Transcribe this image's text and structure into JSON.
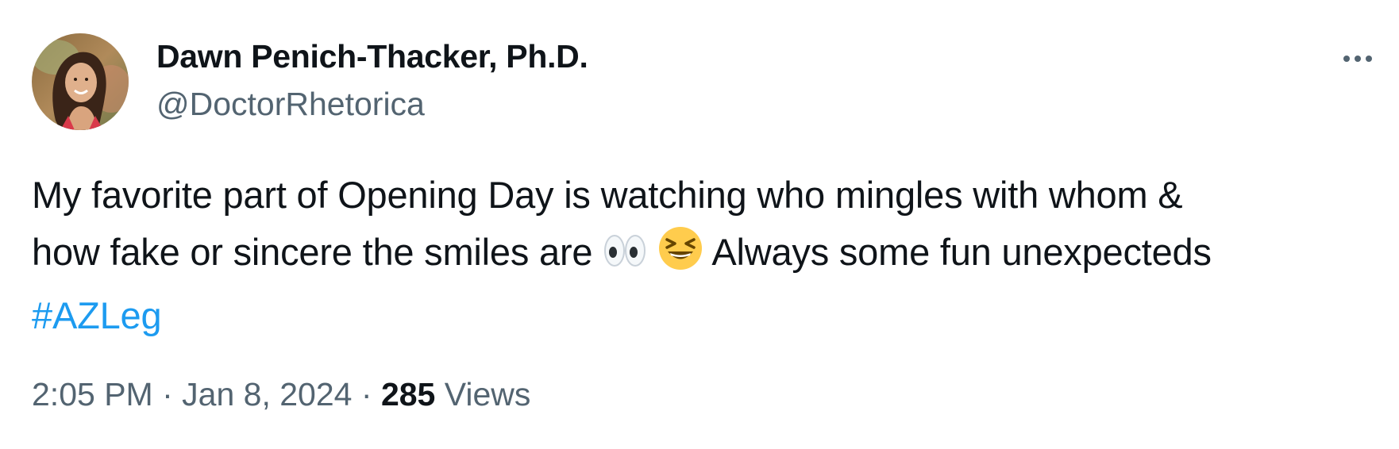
{
  "author": {
    "display_name": "Dawn Penich-Thacker, Ph.D.",
    "handle": "@DoctorRhetorica",
    "avatar_icon": "profile-photo-woman"
  },
  "tweet": {
    "line1": "My favorite part of Opening Day is watching who mingles with whom &",
    "line2_before_emoji": "how fake or sincere the smiles are",
    "emoji_1": "eyes-emoji",
    "emoji_2": "grinning-squinting-face-emoji",
    "line2_after_emoji": "Always some fun unexpecteds",
    "hashtag": "#AZLeg"
  },
  "meta": {
    "time": "2:05 PM",
    "separator": "·",
    "date": "Jan 8, 2024",
    "views_count": "285",
    "views_label": "Views"
  },
  "colors": {
    "link": "#1d9bf0",
    "secondary_text": "#536471",
    "primary_text": "#0f1419"
  }
}
